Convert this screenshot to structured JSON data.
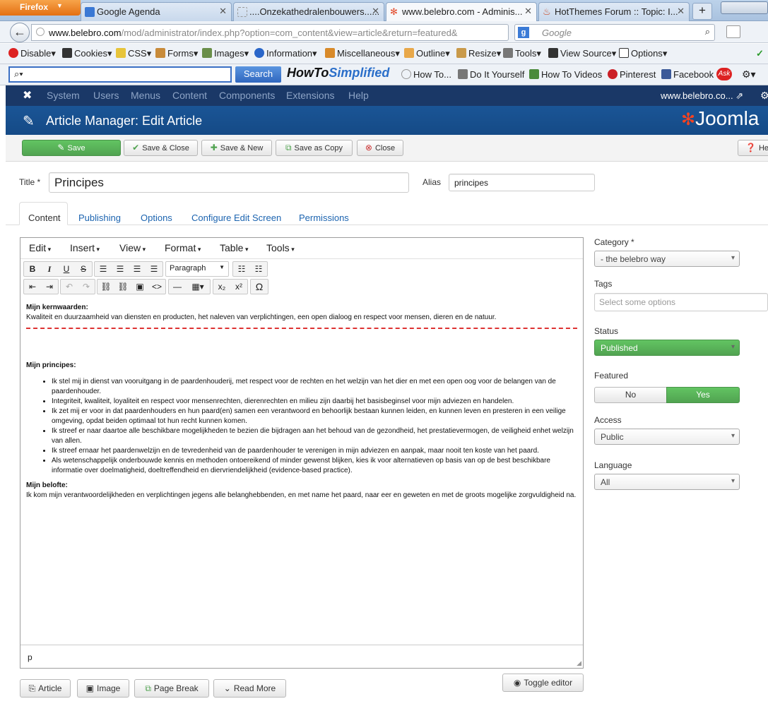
{
  "browser": {
    "firefox_label": "Firefox",
    "tabs": [
      {
        "label": "Google Agenda",
        "icon_color": "#3a78d4"
      },
      {
        "label": "....Onzekathedralenbouwers......",
        "icon_color": "#cccccc"
      },
      {
        "label": "www.belebro.com - Adminis...",
        "icon_color": "#e34a2a"
      },
      {
        "label": "HotThemes Forum :: Topic: I...",
        "icon_color": "#c84a26"
      }
    ],
    "url_host": "www.belebro.com",
    "url_path": "/mod/administrator/index.php?option=com_content&view=article&return=featured&",
    "search_placeholder": "Google",
    "webdev": [
      "Disable",
      "Cookies",
      "CSS",
      "Forms",
      "Images",
      "Information",
      "Miscellaneous",
      "Outline",
      "Resize",
      "Tools",
      "View Source",
      "Options"
    ],
    "toolbar_search_button": "Search",
    "howto": {
      "a": "HowTo",
      "b": "Simplified"
    },
    "toolbar_links": [
      "How To...",
      "Do It Yourself",
      "How To Videos",
      "Pinterest",
      "Facebook"
    ]
  },
  "joomla": {
    "nav": [
      "System",
      "Users",
      "Menus",
      "Content",
      "Components",
      "Extensions",
      "Help"
    ],
    "site_link": "www.belebro.co...",
    "page_title": "Article Manager: Edit Article",
    "brand": "Joomla",
    "buttons": {
      "save": "Save",
      "save_close": "Save & Close",
      "save_new": "Save & New",
      "save_copy": "Save as Copy",
      "close": "Close",
      "help": "Help"
    },
    "title_label": "Title *",
    "title_value": "Principes",
    "alias_label": "Alias",
    "alias_value": "principes",
    "tabs": [
      "Content",
      "Publishing",
      "Options",
      "Configure Edit Screen",
      "Permissions"
    ],
    "editor_menus": [
      "Edit",
      "Insert",
      "View",
      "Format",
      "Table",
      "Tools"
    ],
    "paragraph_select": "Paragraph",
    "content": {
      "h1": "Mijn kernwaarden:",
      "p1": "Kwaliteit en duurzaamheid  van diensten en producten, het naleven van verplichtingen, een open dialoog en respect voor mensen, dieren en de natuur.",
      "h2": "Mijn principes:",
      "items": [
        "Ik stel mij in dienst van vooruitgang in de paardenhouderij, met respect voor de rechten en het welzijn van het dier en met een open oog voor de belangen van de paardenhouder.",
        "Integriteit, kwaliteit, loyaliteit en respect voor mensenrechten, dierenrechten en milieu zijn daarbij het basisbeginsel voor mijn adviezen en handelen.",
        "Ik zet mij er voor in dat paardenhouders en hun paard(en) samen een verantwoord en behoorlijk bestaan kunnen leiden, en kunnen leven en presteren in een veilige omgeving, opdat beiden optimaal tot hun recht kunnen komen.",
        "Ik streef er naar daartoe alle beschikbare mogelijkheden te bezien die bijdragen aan het behoud van de gezondheid, het prestatievermogen, de veiligheid enhet welzijn van allen.",
        "Ik streef ernaar het paardenwelzijn en de tevredenheid van de paardenhouder te verenigen in mijn adviezen en aanpak, maar nooit ten koste van het paard.",
        "Als wetenschappelijk onderbouwde kennis en methoden ontoereikend of minder gewenst blijken, kies ik voor alternatieven op basis van op de best beschikbare informatie over doelmatigheid, doeltreffendheid en diervriendelijkheid (evidence-based practice)."
      ],
      "h3": "Mijn belofte:",
      "p3": "Ik kom mijn verantwoordelijkheden en verplichtingen jegens alle belanghebbenden, en met name het paard, naar eer en geweten en met de groots mogelijke zorgvuldigheid na."
    },
    "status_path": "p",
    "bottom_buttons": {
      "article": "Article",
      "image": "Image",
      "page_break": "Page Break",
      "read_more": "Read More",
      "toggle": "Toggle editor"
    },
    "right": {
      "category_label": "Category *",
      "category_value": "- the belebro way",
      "tags_label": "Tags",
      "tags_placeholder": "Select some options",
      "status_label": "Status",
      "status_value": "Published",
      "featured_label": "Featured",
      "featured_no": "No",
      "featured_yes": "Yes",
      "access_label": "Access",
      "access_value": "Public",
      "language_label": "Language",
      "language_value": "All"
    },
    "colors": {
      "nav": "#1a3867",
      "header": "#1a5596",
      "green": "#51a351",
      "link": "#1c64b0"
    }
  }
}
